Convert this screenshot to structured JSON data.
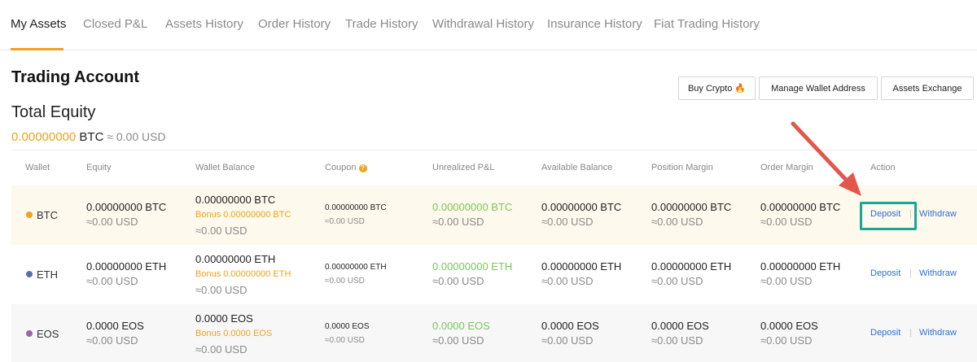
{
  "tabs": [
    {
      "label": "My Assets",
      "active": true
    },
    {
      "label": "Closed P&L",
      "active": false
    },
    {
      "label": "Assets History",
      "active": false
    },
    {
      "label": "Order History",
      "active": false
    },
    {
      "label": "Trade History",
      "active": false
    },
    {
      "label": "Withdrawal History",
      "active": false
    },
    {
      "label": "Insurance History",
      "active": false
    },
    {
      "label": "Fiat Trading History",
      "active": false
    }
  ],
  "account": {
    "title": "Trading Account",
    "equity_label": "Total Equity",
    "equity_btc": "0.00000000",
    "equity_unit": " BTC",
    "equity_usd": " ≈ 0.00 USD"
  },
  "buttons": {
    "buy_crypto": "Buy Crypto",
    "buy_crypto_icon": "fire-icon",
    "manage_wallet": "Manage Wallet Address",
    "assets_exchange": "Assets Exchange"
  },
  "table": {
    "headers": [
      "Wallet",
      "Equity",
      "Wallet Balance",
      "Coupon",
      "Unrealized P&L",
      "Available Balance",
      "Position Margin",
      "Order Margin",
      "Action"
    ],
    "rows": [
      {
        "coin": "BTC",
        "dot_color": "#f0a21a",
        "equity": "0.00000000 BTC",
        "equity_usd": "≈0.00 USD",
        "wallet_balance": "0.00000000 BTC",
        "bonus": "Bonus 0.00000000 BTC",
        "wallet_usd": "≈0.00 USD",
        "coupon": "0.00000000 BTC",
        "coupon_usd": "≈0.00 USD",
        "upnl": "0.00000000 BTC",
        "upnl_usd": "≈0.00 USD",
        "available": "0.00000000 BTC",
        "available_usd": "≈0.00 USD",
        "position_margin": "0.00000000 BTC",
        "position_usd": "≈0.00 USD",
        "order_margin": "0.00000000 BTC",
        "order_usd": "≈0.00 USD",
        "deposit": "Deposit",
        "withdraw": "Withdraw"
      },
      {
        "coin": "ETH",
        "dot_color": "#5a6fa8",
        "equity": "0.00000000 ETH",
        "equity_usd": "≈0.00 USD",
        "wallet_balance": "0.00000000 ETH",
        "bonus": "Bonus 0.00000000 ETH",
        "wallet_usd": "≈0.00 USD",
        "coupon": "0.00000000 ETH",
        "coupon_usd": "≈0.00 USD",
        "upnl": "0.00000000 ETH",
        "upnl_usd": "≈0.00 USD",
        "available": "0.00000000 ETH",
        "available_usd": "≈0.00 USD",
        "position_margin": "0.00000000 ETH",
        "position_usd": "≈0.00 USD",
        "order_margin": "0.00000000 ETH",
        "order_usd": "≈0.00 USD",
        "deposit": "Deposit",
        "withdraw": "Withdraw"
      },
      {
        "coin": "EOS",
        "dot_color": "#a05fae",
        "equity": "0.0000 EOS",
        "equity_usd": "≈0.00 USD",
        "wallet_balance": "0.0000 EOS",
        "bonus": "Bonus 0.0000 EOS",
        "wallet_usd": "≈0.00 USD",
        "coupon": "0.0000 EOS",
        "coupon_usd": "≈0.00 USD",
        "upnl": "0.0000 EOS",
        "upnl_usd": "≈0.00 USD",
        "available": "0.0000 EOS",
        "available_usd": "≈0.00 USD",
        "position_margin": "0.0000 EOS",
        "position_usd": "≈0.00 USD",
        "order_margin": "0.0000 EOS",
        "order_usd": "≈0.00 USD",
        "deposit": "Deposit",
        "withdraw": "Withdraw"
      }
    ]
  },
  "colors": {
    "accent": "#f0a21a",
    "positive": "#7cc65c",
    "link": "#2f6fd0",
    "highlight_box": "#1aa695",
    "annotation_arrow": "#e2574c"
  }
}
